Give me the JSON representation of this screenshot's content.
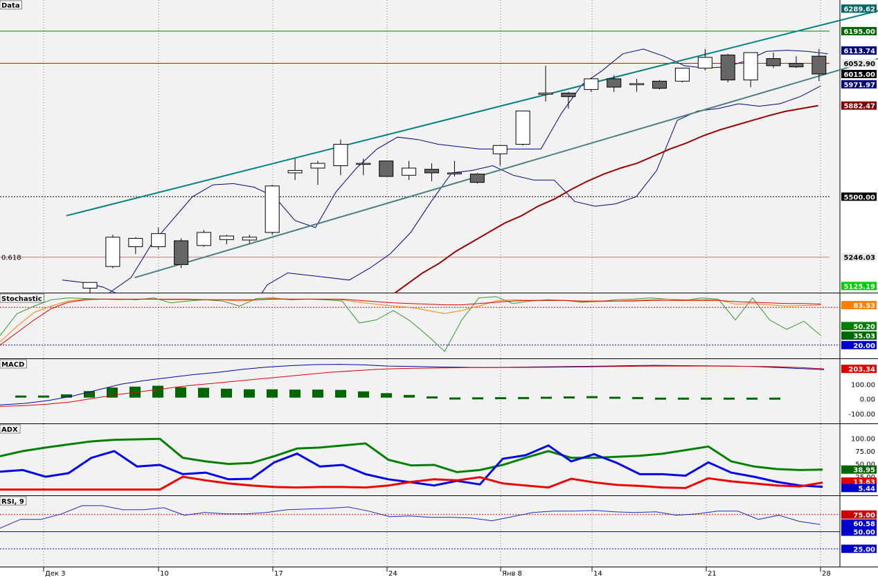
{
  "chart_data": [
    {
      "pane": "price",
      "type": "candlestick",
      "title": "Data",
      "fib_label": "0.618",
      "ylim": [
        5100,
        6320
      ],
      "axis_ticks": [
        "5500.00"
      ],
      "badges": [
        {
          "label": "6289.62",
          "value": 6289.62,
          "bg": "#006666",
          "fg": "#ffffff"
        },
        {
          "label": "6195.00",
          "value": 6195.0,
          "bg": "#006600",
          "fg": "#ffffff"
        },
        {
          "label": "6113.74",
          "value": 6113.74,
          "bg": "#000080",
          "fg": "#ffffff"
        },
        {
          "label": "6052.90",
          "value": 6060,
          "bg": "#e8e8e8",
          "fg": "#000000"
        },
        {
          "label": "6015.00",
          "value": 6015.0,
          "bg": "#000000",
          "fg": "#ffffff"
        },
        {
          "label": "5971.97",
          "value": 5971.97,
          "bg": "#000080",
          "fg": "#ffffff"
        },
        {
          "label": "5882.47",
          "value": 5882.47,
          "bg": "#800000",
          "fg": "#ffffff"
        },
        {
          "label": "5500.00",
          "value": 5500.0,
          "bg": "#000000",
          "fg": "#ffffff"
        },
        {
          "label": "5246.03",
          "value": 5246.03,
          "bg": "#e8e8e8",
          "fg": "#000000"
        },
        {
          "label": "5125.19",
          "value": 5125.19,
          "bg": "#00cc00",
          "fg": "#ffffff"
        }
      ],
      "hlines": [
        {
          "value": 6195,
          "color": "#008000",
          "dash": ""
        },
        {
          "value": 6060,
          "color": "#e00000",
          "dash": ""
        },
        {
          "value": 5500,
          "color": "#000000",
          "dash": "2,2"
        },
        {
          "value": 5246.03,
          "color": "#c08080",
          "dash": ""
        }
      ],
      "candles": [
        {
          "o": 5116,
          "h": 5140,
          "l": 5090,
          "c": 5140
        },
        {
          "o": 5207,
          "h": 5340,
          "l": 5200,
          "c": 5330
        },
        {
          "o": 5290,
          "h": 5330,
          "l": 5260,
          "c": 5325
        },
        {
          "o": 5290,
          "h": 5370,
          "l": 5280,
          "c": 5345
        },
        {
          "o": 5315,
          "h": 5325,
          "l": 5200,
          "c": 5215
        },
        {
          "o": 5295,
          "h": 5360,
          "l": 5290,
          "c": 5350
        },
        {
          "o": 5320,
          "h": 5340,
          "l": 5300,
          "c": 5335
        },
        {
          "o": 5318,
          "h": 5340,
          "l": 5305,
          "c": 5330
        },
        {
          "o": 5350,
          "h": 5550,
          "l": 5340,
          "c": 5545
        },
        {
          "o": 5600,
          "h": 5660,
          "l": 5570,
          "c": 5610
        },
        {
          "o": 5620,
          "h": 5650,
          "l": 5550,
          "c": 5640
        },
        {
          "o": 5630,
          "h": 5740,
          "l": 5590,
          "c": 5720
        },
        {
          "o": 5640,
          "h": 5660,
          "l": 5590,
          "c": 5640
        },
        {
          "o": 5650,
          "h": 5650,
          "l": 5585,
          "c": 5585
        },
        {
          "o": 5590,
          "h": 5650,
          "l": 5570,
          "c": 5620
        },
        {
          "o": 5615,
          "h": 5640,
          "l": 5565,
          "c": 5600
        },
        {
          "o": 5600,
          "h": 5650,
          "l": 5585,
          "c": 5600
        },
        {
          "o": 5595,
          "h": 5600,
          "l": 5555,
          "c": 5560
        },
        {
          "o": 5680,
          "h": 5705,
          "l": 5630,
          "c": 5715
        },
        {
          "o": 5720,
          "h": 5860,
          "l": 5715,
          "c": 5860
        },
        {
          "o": 5930,
          "h": 6050,
          "l": 5900,
          "c": 5935
        },
        {
          "o": 5935,
          "h": 5940,
          "l": 5870,
          "c": 5920
        },
        {
          "o": 5950,
          "h": 6000,
          "l": 5940,
          "c": 5995
        },
        {
          "o": 5995,
          "h": 6010,
          "l": 5940,
          "c": 5960
        },
        {
          "o": 5970,
          "h": 5995,
          "l": 5940,
          "c": 5975
        },
        {
          "o": 5985,
          "h": 5990,
          "l": 5950,
          "c": 5955
        },
        {
          "o": 5985,
          "h": 6040,
          "l": 5980,
          "c": 6040
        },
        {
          "o": 6040,
          "h": 6120,
          "l": 6030,
          "c": 6085
        },
        {
          "o": 6095,
          "h": 6100,
          "l": 5980,
          "c": 5990
        },
        {
          "o": 5990,
          "h": 6105,
          "l": 5960,
          "c": 6105
        },
        {
          "o": 6080,
          "h": 6105,
          "l": 6040,
          "c": 6050
        },
        {
          "o": 6060,
          "h": 6090,
          "l": 6040,
          "c": 6045
        },
        {
          "o": 6090,
          "h": 6120,
          "l": 5985,
          "c": 6015
        }
      ],
      "channel_upper": [
        [
          2,
          5420
        ],
        [
          38,
          6289.62
        ]
      ],
      "channel_lower": [
        [
          5,
          5160
        ],
        [
          38,
          6090
        ]
      ],
      "bollinger_upper": [
        5000,
        5100,
        5160,
        5300,
        5400,
        5500,
        5550,
        5555,
        5540,
        5500,
        5400,
        5370,
        5520,
        5620,
        5700,
        5750,
        5740,
        5720,
        5710,
        5700,
        5700,
        5700,
        5700,
        5850,
        5970,
        6030,
        6100,
        6120,
        6090,
        6050,
        6040,
        6045,
        6070,
        6110,
        6115,
        6110,
        6100
      ],
      "bollinger_lower": [
        5150,
        5140,
        5120,
        5080,
        5050,
        5030,
        5000,
        5000,
        5000,
        5000,
        5130,
        5180,
        5170,
        5160,
        5150,
        5200,
        5260,
        5350,
        5480,
        5600,
        5610,
        5630,
        5590,
        5570,
        5570,
        5480,
        5460,
        5470,
        5500,
        5610,
        5820,
        5860,
        5870,
        5890,
        5880,
        5890,
        5920,
        5965
      ],
      "ma": [
        4980,
        4990,
        5000,
        5010,
        5020,
        5050,
        5080,
        5130,
        5180,
        5220,
        5270,
        5310,
        5350,
        5390,
        5420,
        5460,
        5490,
        5530,
        5565,
        5595,
        5620,
        5640,
        5670,
        5700,
        5725,
        5755,
        5780,
        5800,
        5820,
        5840,
        5858,
        5870,
        5882.47
      ]
    },
    {
      "pane": "stochastic",
      "type": "line",
      "title": "Stochastic",
      "ylim": [
        0,
        100
      ],
      "badges": [
        {
          "label": "83.53",
          "value": 83.53,
          "bg": "#ff8000",
          "fg": "#ffffff"
        },
        {
          "label": "50.20",
          "value": 50.2,
          "bg": "#008000",
          "fg": "#ffffff"
        },
        {
          "label": "35.03",
          "value": 35.03,
          "bg": "#006600",
          "fg": "#ffffff"
        },
        {
          "label": "20.00",
          "value": 20.0,
          "bg": "#0000cc",
          "fg": "#ffffff"
        }
      ],
      "levels": [
        80,
        20
      ],
      "series": [
        {
          "color": "#339933",
          "values": [
            35,
            70,
            82,
            92,
            95,
            94,
            93,
            93,
            92,
            95,
            87,
            90,
            92,
            90,
            82,
            94,
            95,
            92,
            93,
            92,
            90,
            55,
            60,
            75,
            58,
            35,
            10,
            60,
            95,
            97,
            86,
            90,
            92,
            91,
            88,
            89,
            92,
            93,
            95,
            93,
            91,
            95,
            93,
            60,
            95,
            60,
            45,
            58,
            35
          ]
        },
        {
          "color": "#ff8000",
          "values": [
            25,
            50,
            72,
            82,
            90,
            93,
            93,
            92,
            93,
            93,
            92,
            92,
            92,
            92,
            90,
            92,
            94,
            93,
            93,
            93,
            92,
            88,
            85,
            82,
            80,
            75,
            70,
            75,
            82,
            90,
            92,
            91,
            91,
            91,
            89,
            89,
            90,
            91,
            92,
            93,
            92,
            92,
            92,
            85,
            86,
            84,
            82,
            83,
            83.53
          ]
        },
        {
          "color": "#e00000",
          "values": [
            20,
            40,
            60,
            78,
            88,
            92,
            93,
            93,
            93,
            93,
            93,
            93,
            92,
            92,
            92,
            92,
            93,
            93,
            93,
            93,
            93,
            91,
            89,
            87,
            86,
            85,
            84,
            84,
            86,
            88,
            90,
            91,
            91,
            91,
            90,
            90,
            90,
            90,
            91,
            91,
            91,
            91,
            91,
            89,
            88,
            87,
            86,
            86,
            85
          ]
        }
      ]
    },
    {
      "pane": "macd",
      "type": "bar",
      "title": "MACD",
      "ylim": [
        -160,
        260
      ],
      "axis_ticks": [
        100,
        0,
        -100
      ],
      "axis_tick_labels": [
        "100.00",
        "0.00",
        "-100.00"
      ],
      "badges": [
        {
          "label": "203.34",
          "value": 203.34,
          "bg": "#e00000",
          "fg": "#ffffff"
        }
      ],
      "histogram": [
        14,
        14,
        22,
        44,
        68,
        74,
        80,
        70,
        66,
        60,
        56,
        56,
        54,
        54,
        52,
        42,
        30,
        18,
        8,
        1,
        2,
        3,
        4,
        6,
        8,
        10,
        6,
        4,
        -4,
        -4,
        -6,
        -6,
        -9,
        -14
      ],
      "macd_line": [
        -40,
        -30,
        -10,
        20,
        60,
        100,
        125,
        145,
        165,
        180,
        200,
        215,
        225,
        232,
        234,
        230,
        222,
        220,
        216,
        214,
        212,
        214,
        216,
        218,
        220,
        222,
        225,
        227,
        225,
        224,
        222,
        220,
        213,
        206,
        198
      ],
      "signal_line": [
        -50,
        -45,
        -35,
        -20,
        5,
        30,
        50,
        70,
        90,
        105,
        120,
        135,
        150,
        165,
        180,
        190,
        200,
        206,
        208,
        210,
        212,
        212,
        213,
        214,
        215,
        217,
        219,
        221,
        222,
        222,
        222,
        221,
        220,
        218,
        212,
        203.34
      ]
    },
    {
      "pane": "adx",
      "type": "line",
      "title": "ADX",
      "ylim": [
        -10,
        125
      ],
      "axis_ticks": [
        100,
        75,
        50,
        25
      ],
      "axis_tick_labels": [
        "100.00",
        "75.00",
        "50.00",
        "25.00"
      ],
      "badges": [
        {
          "label": "38.95",
          "value": 38.95,
          "bg": "#006600",
          "fg": "#ffffff"
        },
        {
          "label": "13.63",
          "value": 15.5,
          "bg": "#e00000",
          "fg": "#ffffff"
        },
        {
          "label": "5.44",
          "value": 3.0,
          "bg": "#0000cc",
          "fg": "#ffffff"
        }
      ],
      "series": [
        {
          "color": "#008000",
          "values": [
            65,
            75,
            82,
            88,
            94,
            97,
            98,
            99,
            62,
            55,
            50,
            52,
            65,
            80,
            82,
            86,
            90,
            58,
            47,
            48,
            34,
            38,
            48,
            62,
            75,
            62,
            62,
            64,
            66,
            70,
            77,
            84,
            55,
            45,
            40,
            38,
            38.95
          ]
        },
        {
          "color": "#0000ee",
          "values": [
            35,
            38,
            25,
            32,
            62,
            75,
            45,
            48,
            30,
            33,
            20,
            21,
            53,
            70,
            45,
            48,
            30,
            20,
            14,
            8,
            17,
            10,
            60,
            67,
            86,
            55,
            69,
            52,
            30,
            30,
            27,
            53,
            33,
            25,
            15,
            8,
            5.44
          ]
        },
        {
          "color": "#ee0000",
          "values": [
            0,
            0,
            0,
            0,
            0,
            0,
            0,
            0,
            25,
            18,
            12,
            8,
            5,
            4,
            5,
            5,
            4,
            8,
            15,
            20,
            18,
            24,
            12,
            8,
            4,
            21,
            14,
            9,
            7,
            4,
            3,
            22,
            16,
            12,
            8,
            6,
            13.63
          ]
        }
      ]
    },
    {
      "pane": "rsi",
      "type": "line",
      "title": "RSI, 9",
      "ylim": [
        0,
        100
      ],
      "levels": [
        75,
        50,
        25
      ],
      "badges": [
        {
          "label": "75.00",
          "value": 75,
          "bg": "#cc0000",
          "fg": "#ffffff"
        },
        {
          "label": "60.58",
          "value": 62,
          "bg": "#0000cc",
          "fg": "#ffffff"
        },
        {
          "label": "50.00",
          "value": 50,
          "bg": "#0000cc",
          "fg": "#ffffff"
        },
        {
          "label": "25.00",
          "value": 25,
          "bg": "#0000cc",
          "fg": "#ffffff"
        }
      ],
      "series": [
        {
          "color": "#2222cc",
          "values": [
            55,
            68,
            68,
            76,
            88,
            88,
            82,
            82,
            85,
            74,
            78,
            76,
            76,
            78,
            82,
            83,
            84,
            86,
            80,
            72,
            73,
            71,
            71,
            70,
            66,
            72,
            78,
            80,
            80,
            81,
            79,
            78,
            79,
            74,
            76,
            80,
            80,
            68,
            74,
            65,
            60.58
          ]
        }
      ]
    }
  ],
  "x_axis": {
    "labels": [
      "Дек 3",
      "10",
      "17",
      "24",
      "Янв 8",
      "14",
      "21",
      "28"
    ]
  },
  "colors": {
    "pane_bg": "#f2f2f2",
    "channel": "#008080",
    "channel_lower": "#4a8080",
    "bollinger": "#00008b",
    "ma": "#990000",
    "macd_hist": "#006600",
    "grid": "#808080"
  }
}
